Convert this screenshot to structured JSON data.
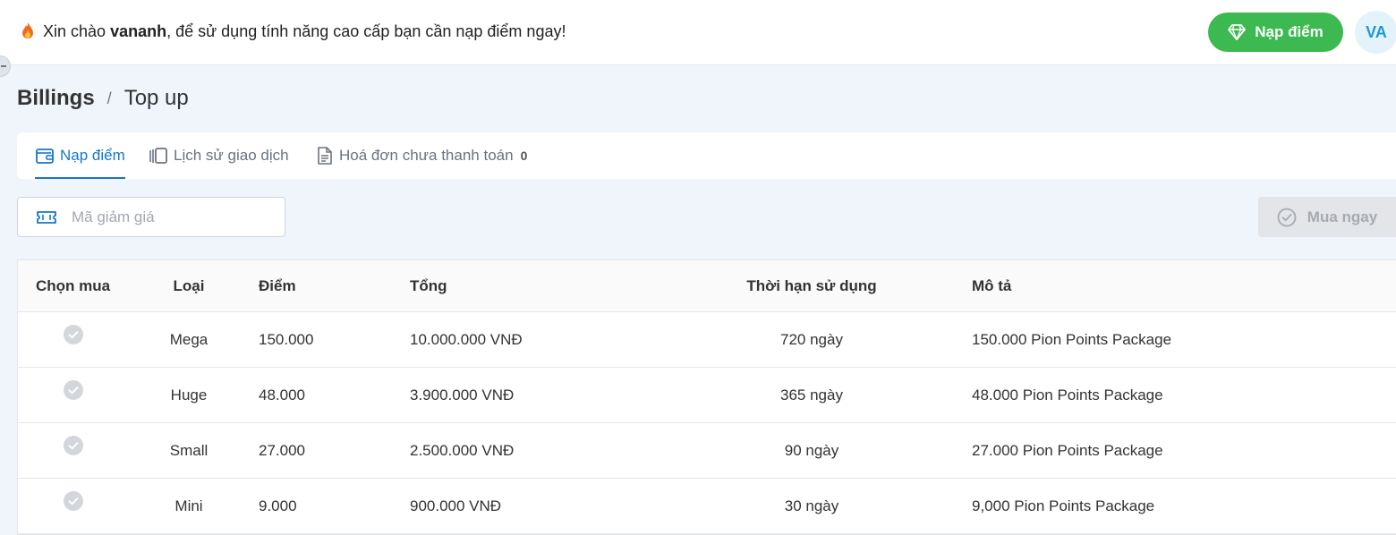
{
  "header": {
    "greeting_prefix": "Xin chào",
    "username": "vananh",
    "greeting_suffix": ", để sử dụng tính năng cao cấp bạn cần nạp điểm ngay!",
    "topup_label": "Nạp điểm",
    "avatar_initials": "VA",
    "flame_icon": "flame-icon",
    "topup_icon": "diamond-icon",
    "accent_color": "#3cb950"
  },
  "breadcrumb": {
    "root": "Billings",
    "separator": "/",
    "current": "Top up"
  },
  "tabs": [
    {
      "label": "Nạp điểm",
      "icon": "wallet-icon",
      "active": true
    },
    {
      "label": "Lịch sử giao dịch",
      "icon": "history-icon",
      "active": false
    },
    {
      "label": "Hoá đơn chưa thanh toán",
      "icon": "invoice-icon",
      "count": "0",
      "active": false
    }
  ],
  "coupon": {
    "placeholder": "Mã giảm giá",
    "icon": "ticket-icon"
  },
  "buy_button": {
    "label": "Mua ngay",
    "icon": "check-circle-icon",
    "disabled": true
  },
  "table": {
    "columns": [
      "Chọn mua",
      "Loại",
      "Điểm",
      "Tổng",
      "Thời hạn sử dụng",
      "Mô tả"
    ],
    "rows": [
      {
        "type": "Mega",
        "points": "150.000",
        "total": "10.000.000 VNĐ",
        "duration": "720 ngày",
        "description": "150.000 Pion Points Package"
      },
      {
        "type": "Huge",
        "points": "48.000",
        "total": "3.900.000 VNĐ",
        "duration": "365 ngày",
        "description": "48.000 Pion Points Package"
      },
      {
        "type": "Small",
        "points": "27.000",
        "total": "2.500.000 VNĐ",
        "duration": "90 ngày",
        "description": "27.000 Pion Points Package"
      },
      {
        "type": "Mini",
        "points": "9.000",
        "total": "900.000 VNĐ",
        "duration": "30 ngày",
        "description": "9,000 Pion Points Package"
      }
    ]
  }
}
